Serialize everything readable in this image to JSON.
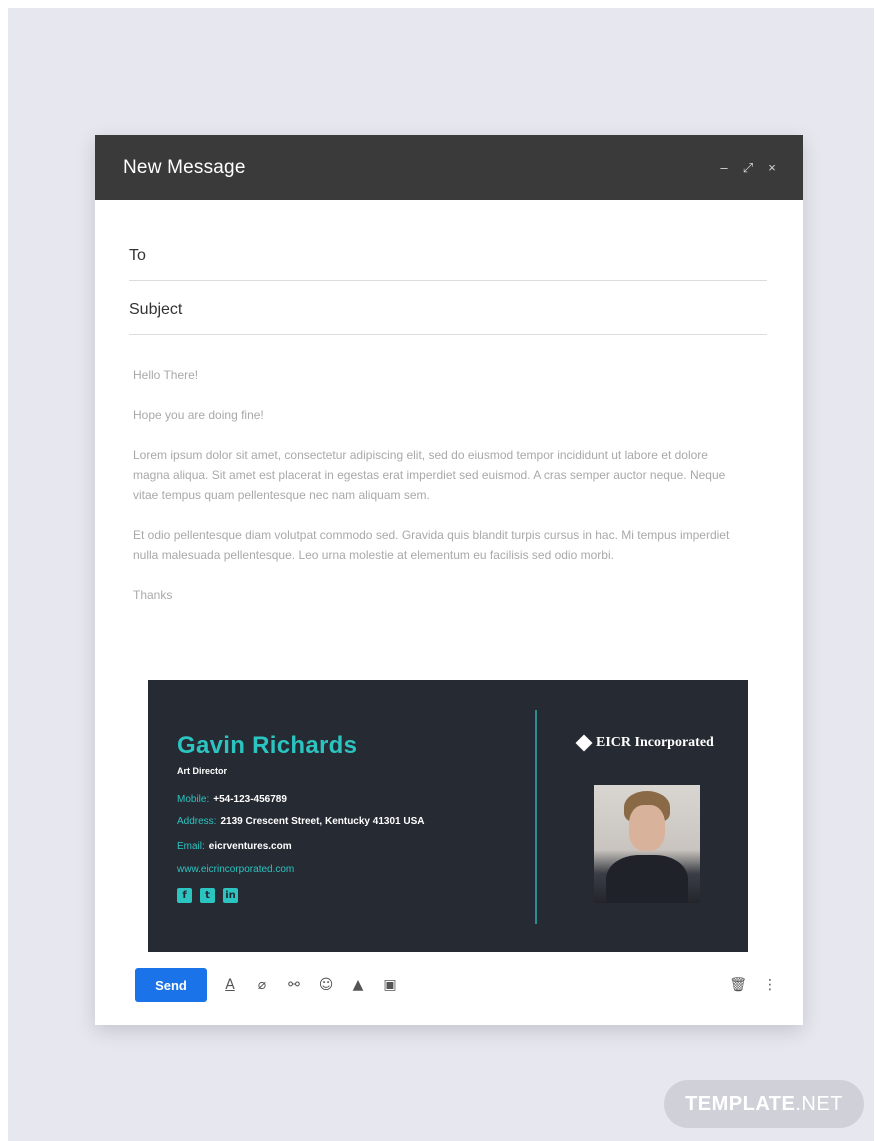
{
  "window": {
    "title": "New Message",
    "controls": {
      "minimize": "–",
      "expand": "⤢",
      "close": "×"
    }
  },
  "fields": {
    "to_label": "To",
    "subject_label": "Subject"
  },
  "body": {
    "greeting": "Hello There!",
    "line2": "Hope you are doing fine!",
    "para1": "Lorem ipsum dolor sit amet, consectetur adipiscing elit, sed do eiusmod tempor incididunt ut labore et dolore magna aliqua. Sit amet est placerat in egestas erat imperdiet sed euismod. A cras semper auctor neque. Neque vitae tempus quam pellentesque nec nam aliquam sem.",
    "para2": "Et odio pellentesque diam volutpat commodo sed. Gravida quis blandit turpis cursus in hac. Mi tempus imperdiet nulla malesuada pellentesque. Leo urna molestie at elementum eu facilisis sed odio morbi.",
    "closing": "Thanks"
  },
  "signature": {
    "name": "Gavin Richards",
    "role": "Art Director",
    "mobile_label": "Mobile:",
    "mobile": "+54-123-456789",
    "address_label": "Address:",
    "address": "2139 Crescent Street, Kentucky 41301 USA",
    "email_label": "Email:",
    "email": "eicrventures.com",
    "website": "www.eicrincorporated.com",
    "company": "EICR Incorporated",
    "social": [
      "f",
      "t",
      "in"
    ],
    "colors": {
      "background": "#262a33",
      "accent": "#2cc4c1"
    }
  },
  "toolbar": {
    "send_label": "Send",
    "icons": [
      "format-text-icon",
      "attach-icon",
      "link-icon",
      "emoji-icon",
      "drive-icon",
      "photo-icon"
    ],
    "accent": "#1a73e8"
  },
  "watermark": {
    "brand": "TEMPLATE",
    "suffix": ".NET"
  }
}
